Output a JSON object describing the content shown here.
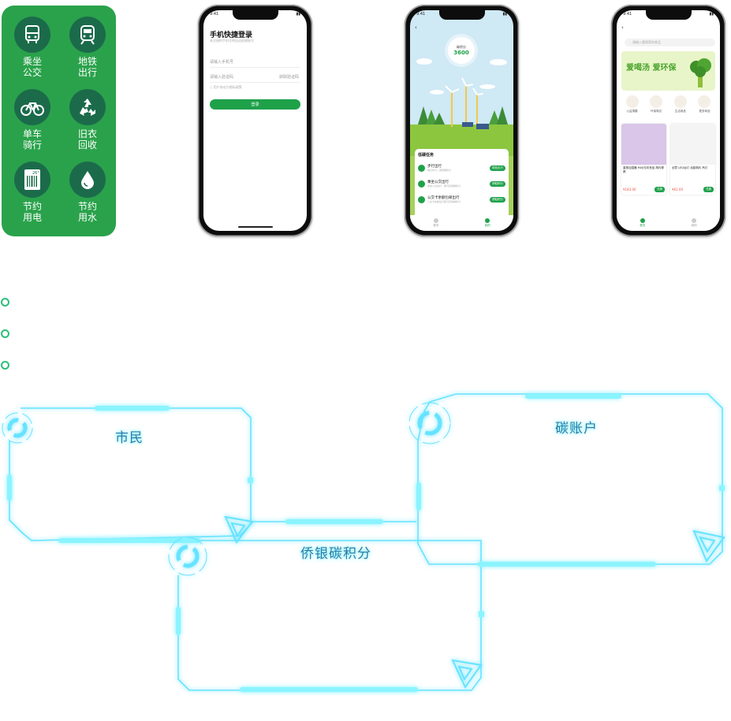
{
  "categories": [
    {
      "label": "乘坐\n公交",
      "icon": "bus-icon"
    },
    {
      "label": "地铁\n出行",
      "icon": "metro-icon"
    },
    {
      "label": "单车\n骑行",
      "icon": "bicycle-icon"
    },
    {
      "label": "旧衣\n回收",
      "icon": "recycle-icon"
    },
    {
      "label": "节约\n用电",
      "icon": "electric-meter-icon"
    },
    {
      "label": "节约\n用水",
      "icon": "water-drop-icon"
    }
  ],
  "phone_login": {
    "status_time": "9:41",
    "title": "手机快捷登录",
    "subtitle": "未注册的手机号将自动创建账号",
    "phone_placeholder": "请输入手机号",
    "code_placeholder": "请输入验证码",
    "get_code": "获取验证码",
    "agreement": "用户协议与隐私政策",
    "login_button": "登录"
  },
  "phone_energy": {
    "status_time": "9:41",
    "energy_label": "碳积分",
    "energy_value": "3600",
    "task_title": "低碳任务",
    "tasks": [
      {
        "name": "步行出行",
        "desc": "每日步行，累积碳积分",
        "button": "绿色出行"
      },
      {
        "name": "乘坐公交出行",
        "desc": "乘坐公交出行，即可获得碳积分",
        "button": "获取积分"
      },
      {
        "name": "公交卡余额包邮出行",
        "desc": "公交卡余额出行即可获得碳积分",
        "button": "获取积分"
      }
    ],
    "tabs": [
      "首页",
      "我的"
    ]
  },
  "phone_mall": {
    "status_time": "9:41",
    "search_placeholder": "请输入要搜索的商品",
    "banner": "爱喝汤 爱环保",
    "cats": [
      "公益捐赠",
      "环保周边",
      "生活用品",
      "更多商品"
    ],
    "goods": [
      {
        "name": "香薰加湿器 MUJI无印良品 简约便携",
        "price": "¥183.00",
        "button": "兑换"
      },
      {
        "name": "创意 LED台灯 北欧简约 吊灯",
        "price": "¥61.00",
        "button": "兑换"
      }
    ],
    "tabs": [
      "首页",
      "我的"
    ]
  },
  "nodes": {
    "citizen": "市民",
    "bank": "侨银碳积分",
    "account": "碳账户"
  },
  "colors": {
    "brand_green": "#2aa24b",
    "icon_circle": "#1b6b4b",
    "neon": "#5ef0ff",
    "neon_line": "#66e3ff"
  }
}
